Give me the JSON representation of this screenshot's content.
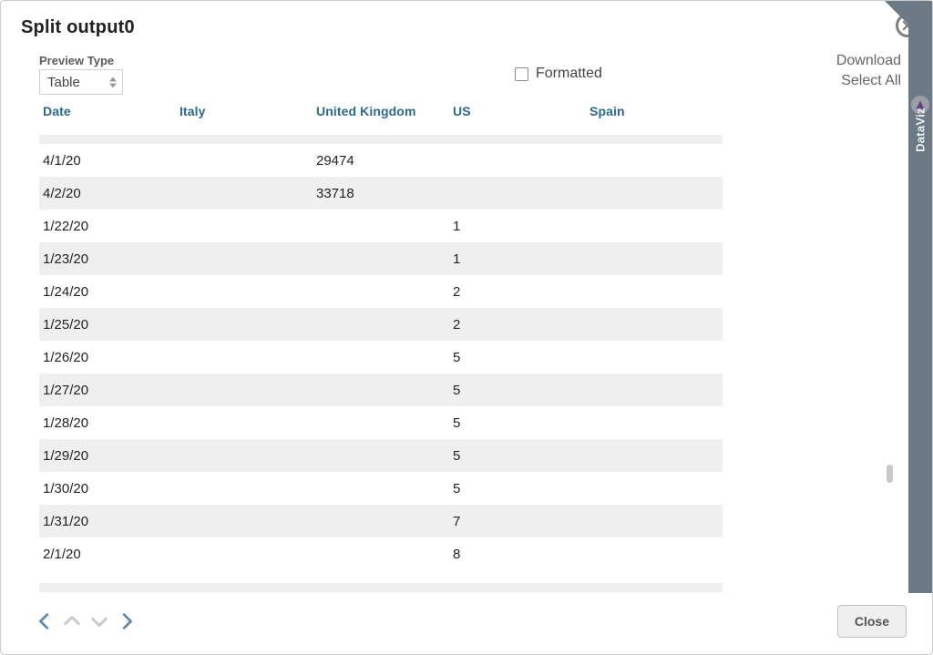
{
  "title": "Split output0",
  "previewType": {
    "label": "Preview Type",
    "value": "Table"
  },
  "formatted": {
    "label": "Formatted",
    "checked": false
  },
  "links": {
    "download": "Download",
    "selectAll": "Select All"
  },
  "close": {
    "label": "Close"
  },
  "sidetab": {
    "label": "DataViz"
  },
  "table": {
    "columns": [
      "Date",
      "Italy",
      "United Kingdom",
      "US",
      "Spain"
    ],
    "rows": [
      {
        "date": "4/1/20",
        "italy": "",
        "uk": "29474",
        "us": "",
        "spain": ""
      },
      {
        "date": "4/2/20",
        "italy": "",
        "uk": "33718",
        "us": "",
        "spain": ""
      },
      {
        "date": "1/22/20",
        "italy": "",
        "uk": "",
        "us": "1",
        "spain": ""
      },
      {
        "date": "1/23/20",
        "italy": "",
        "uk": "",
        "us": "1",
        "spain": ""
      },
      {
        "date": "1/24/20",
        "italy": "",
        "uk": "",
        "us": "2",
        "spain": ""
      },
      {
        "date": "1/25/20",
        "italy": "",
        "uk": "",
        "us": "2",
        "spain": ""
      },
      {
        "date": "1/26/20",
        "italy": "",
        "uk": "",
        "us": "5",
        "spain": ""
      },
      {
        "date": "1/27/20",
        "italy": "",
        "uk": "",
        "us": "5",
        "spain": ""
      },
      {
        "date": "1/28/20",
        "italy": "",
        "uk": "",
        "us": "5",
        "spain": ""
      },
      {
        "date": "1/29/20",
        "italy": "",
        "uk": "",
        "us": "5",
        "spain": ""
      },
      {
        "date": "1/30/20",
        "italy": "",
        "uk": "",
        "us": "5",
        "spain": ""
      },
      {
        "date": "1/31/20",
        "italy": "",
        "uk": "",
        "us": "7",
        "spain": ""
      },
      {
        "date": "2/1/20",
        "italy": "",
        "uk": "",
        "us": "8",
        "spain": ""
      }
    ]
  }
}
